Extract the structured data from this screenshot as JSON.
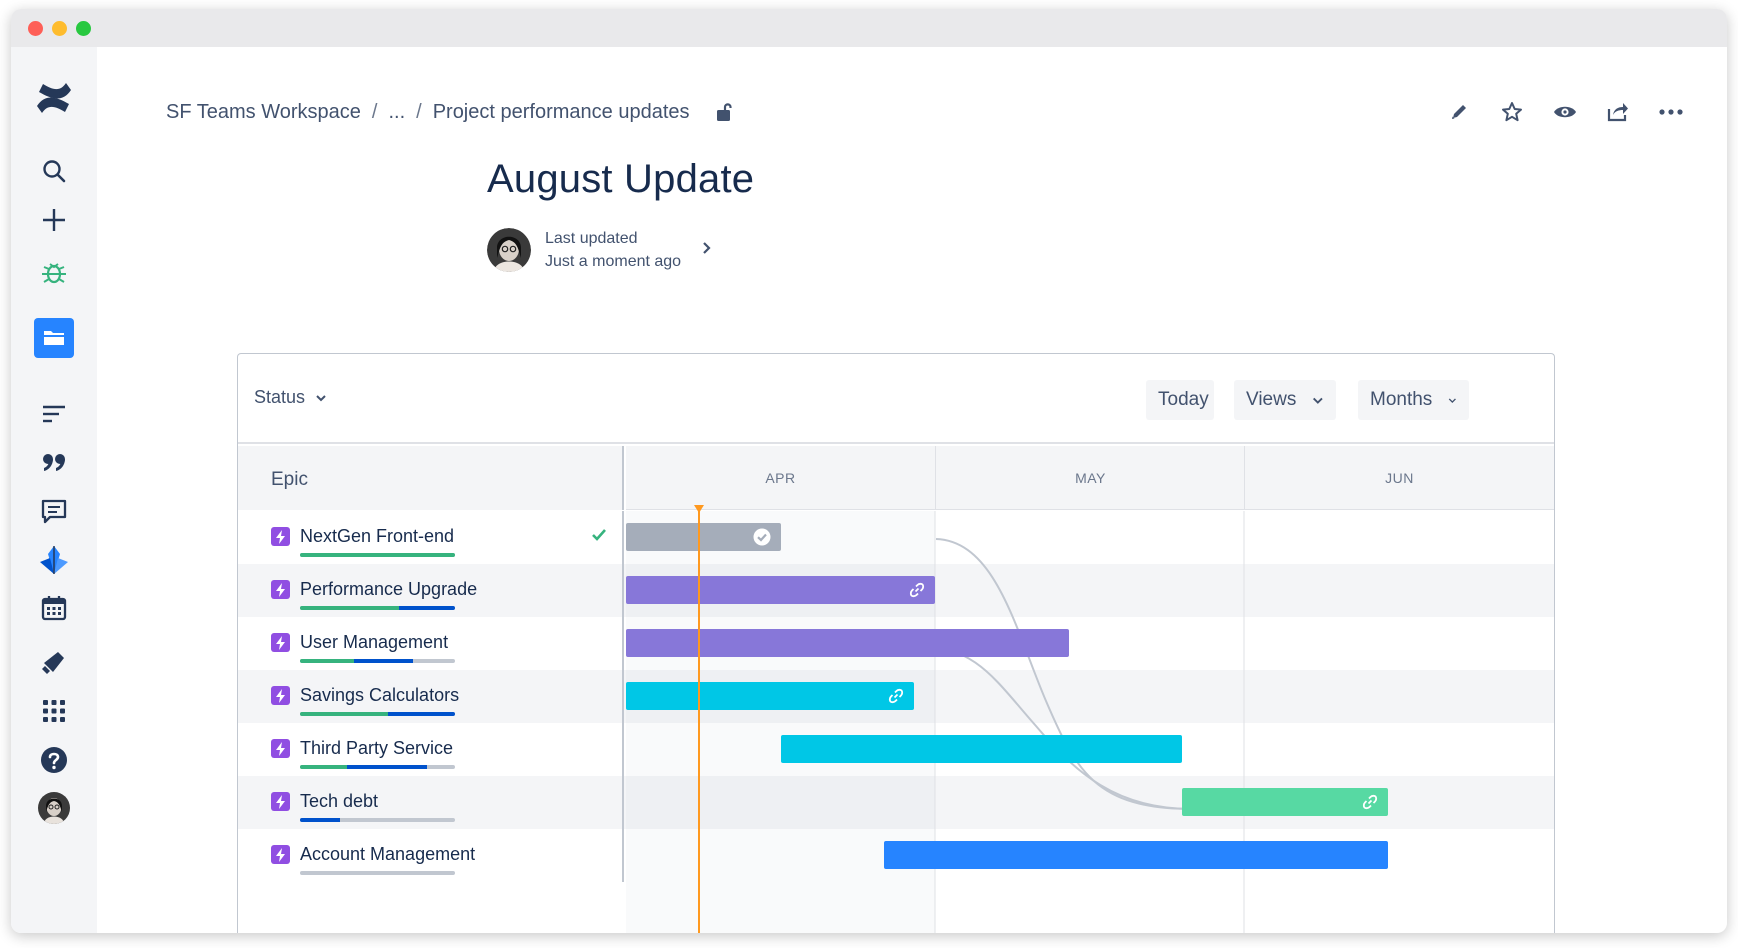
{
  "breadcrumb": {
    "workspace": "SF Teams Workspace",
    "ellipsis": "...",
    "page": "Project performance updates",
    "separator": "/"
  },
  "page": {
    "title": "August Update",
    "byline_label": "Last updated",
    "byline_time": "Just a moment ago"
  },
  "sidebar_icons": [
    "confluence-logo-icon",
    "search-icon",
    "plus-icon",
    "bug-icon",
    "folder-icon",
    "list-icon",
    "quote-icon",
    "comment-icon",
    "anchor-icon",
    "calendar-icon",
    "megaphone-icon",
    "apps-grid-icon",
    "help-icon",
    "avatar"
  ],
  "header_actions": [
    "edit-icon",
    "star-icon",
    "watch-icon",
    "share-icon",
    "more-icon"
  ],
  "roadmap": {
    "status_label": "Status",
    "today_label": "Today",
    "views_label": "Views",
    "months_label": "Months",
    "epic_header": "Epic",
    "months": [
      "APR",
      "MAY",
      "JUN"
    ],
    "epics": [
      {
        "name": "NextGen Front-end",
        "done_fraction": 1.0,
        "inprogress_fraction": 0.0,
        "complete": true,
        "bar_color": "#a5adba",
        "bar_start": "Apr 1",
        "bar_end": "Apr 16"
      },
      {
        "name": "Performance Upgrade",
        "done_fraction": 0.64,
        "inprogress_fraction": 0.36,
        "complete": false,
        "bar_color": "#8777d9",
        "bar_start": "Apr 1",
        "bar_end": "May 1"
      },
      {
        "name": "User Management",
        "done_fraction": 0.35,
        "inprogress_fraction": 0.38,
        "complete": false,
        "bar_color": "#8777d9",
        "bar_start": "Apr 1",
        "bar_end": "May 14"
      },
      {
        "name": "Savings Calculators",
        "done_fraction": 0.57,
        "inprogress_fraction": 0.43,
        "complete": false,
        "bar_color": "#00c7e6",
        "bar_start": "Apr 1",
        "bar_end": "Apr 29"
      },
      {
        "name": "Third Party Service",
        "done_fraction": 0.3,
        "inprogress_fraction": 0.52,
        "complete": false,
        "bar_color": "#00c7e6",
        "bar_start": "Apr 16",
        "bar_end": "May 25"
      },
      {
        "name": "Tech debt",
        "done_fraction": 0.0,
        "inprogress_fraction": 0.26,
        "complete": false,
        "bar_color": "#57d9a3",
        "bar_start": "May 25",
        "bar_end": "Jun 15"
      },
      {
        "name": "Account Management",
        "done_fraction": 0.0,
        "inprogress_fraction": 0.0,
        "complete": false,
        "bar_color": "#2684ff",
        "bar_start": "Apr 26",
        "bar_end": "Jun 15"
      }
    ],
    "today": "Apr 8",
    "colors": {
      "today_line": "#ff991f",
      "epic_icon": "#904ee2",
      "done": "#36b37e",
      "in_progress": "#0052cc",
      "todo": "#c1c7d0"
    }
  }
}
